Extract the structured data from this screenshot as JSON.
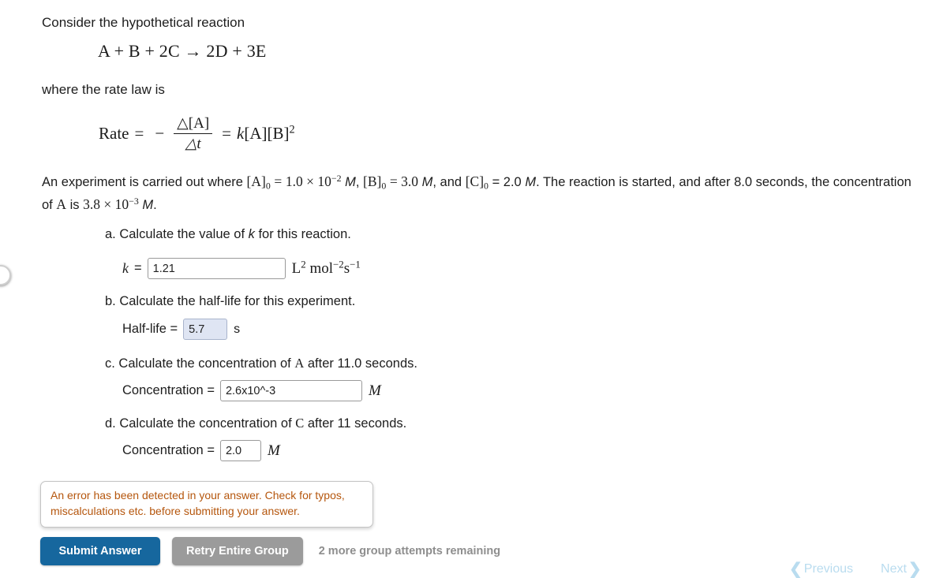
{
  "problem": {
    "intro": "Consider the hypothetical reaction",
    "reaction_equation": "A + B + 2C → 2D + 3E",
    "rate_law_intro": "where the rate law is",
    "rate_law": {
      "lhs": "Rate",
      "equals": "=",
      "minus": "−",
      "numerator": "△[A]",
      "denominator": "△t",
      "equals2": "=",
      "rhs": "k[A][B]²"
    },
    "experiment_text_1": "An experiment is carried out where",
    "A0_label": "[A]",
    "A0_sub": "0",
    "A0_eq": "=",
    "A0_value": "1.0 × 10",
    "A0_exp": "−2",
    "A0_unit": "M",
    "B0_label": "[B]",
    "B0_sub": "0",
    "B0_eq_value": "= 3.0",
    "B0_unit": "M",
    "and_text": ", and",
    "C0_label": "[C]",
    "C0_sub": "0",
    "C0_eq_value": "= 2.0",
    "C0_unit": "M",
    "experiment_text_2": ". The reaction is started, and after 8.0 seconds, the concentration of",
    "species_A": "A",
    "experiment_text_3": "is",
    "A_final_value": "3.8 × 10",
    "A_final_exp": "−3",
    "A_final_unit": "M",
    "period": "."
  },
  "questions": [
    {
      "id": "a",
      "prompt_prefix": "a. Calculate the value of",
      "prompt_var": "k",
      "prompt_suffix": "for this reaction.",
      "answer_label": "k",
      "answer_equals": "=",
      "answer_value": "1.21",
      "units_base": "L",
      "units_sup1": "2",
      "units_mol": "mol",
      "units_sup2": "−2",
      "units_s": "s",
      "units_sup3": "−1"
    },
    {
      "id": "b",
      "prompt": "b. Calculate the half-life for this experiment.",
      "answer_label": "Half-life =",
      "answer_value": "5.7",
      "units": "s"
    },
    {
      "id": "c",
      "prompt_prefix": "c. Calculate the concentration of",
      "prompt_species": "A",
      "prompt_suffix": "after 11.0 seconds.",
      "answer_label": "Concentration =",
      "answer_value": "2.6x10^-3",
      "units": "M"
    },
    {
      "id": "d",
      "prompt_prefix": "d. Calculate the concentration of",
      "prompt_species": "C",
      "prompt_suffix": "after 11 seconds.",
      "answer_label": "Concentration =",
      "answer_value": "2.0",
      "units": "M"
    }
  ],
  "error": {
    "line1": "An error has been detected in your answer. Check for typos,",
    "line2": "miscalculations etc. before submitting your answer.",
    "color": "#b5560d"
  },
  "actions": {
    "submit_label": "Submit Answer",
    "retry_label": "Retry Entire Group",
    "attempts_text": "2 more group attempts remaining",
    "submit_color": "#16679e",
    "retry_color": "#9b9b9b"
  },
  "navigation": {
    "previous_label": "Previous",
    "previous_chevron": "❮",
    "next_label": "Next",
    "next_chevron": "❯",
    "color": "#b9dcef"
  }
}
